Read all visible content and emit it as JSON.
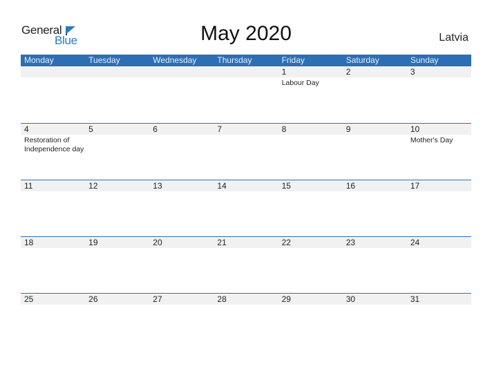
{
  "logo": {
    "word1": "General",
    "word2": "Blue"
  },
  "title": "May 2020",
  "country": "Latvia",
  "accent_color": "#2d6fb3",
  "weekdays": [
    "Monday",
    "Tuesday",
    "Wednesday",
    "Thursday",
    "Friday",
    "Saturday",
    "Sunday"
  ],
  "weeks": [
    {
      "dates": [
        "",
        "",
        "",
        "",
        "1",
        "2",
        "3"
      ],
      "events": [
        "",
        "",
        "",
        "",
        "Labour Day",
        "",
        ""
      ]
    },
    {
      "dates": [
        "4",
        "5",
        "6",
        "7",
        "8",
        "9",
        "10"
      ],
      "events": [
        "Restoration of Independence day",
        "",
        "",
        "",
        "",
        "",
        "Mother's Day"
      ]
    },
    {
      "dates": [
        "11",
        "12",
        "13",
        "14",
        "15",
        "16",
        "17"
      ],
      "events": [
        "",
        "",
        "",
        "",
        "",
        "",
        ""
      ]
    },
    {
      "dates": [
        "18",
        "19",
        "20",
        "21",
        "22",
        "23",
        "24"
      ],
      "events": [
        "",
        "",
        "",
        "",
        "",
        "",
        ""
      ]
    },
    {
      "dates": [
        "25",
        "26",
        "27",
        "28",
        "29",
        "30",
        "31"
      ],
      "events": [
        "",
        "",
        "",
        "",
        "",
        "",
        ""
      ]
    }
  ]
}
